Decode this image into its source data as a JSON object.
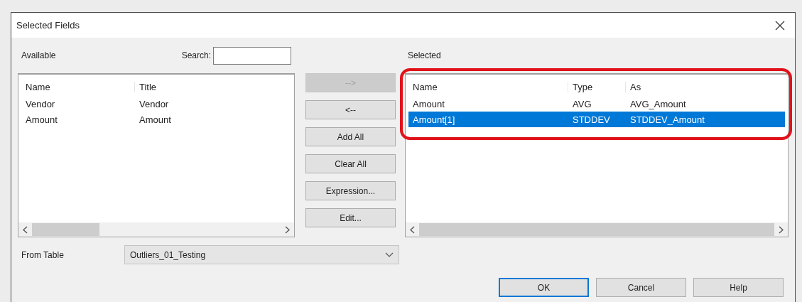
{
  "window": {
    "title": "Selected Fields"
  },
  "available": {
    "label": "Available",
    "search_label": "Search:",
    "columns": [
      "Name",
      "Title"
    ],
    "rows": [
      {
        "cells": [
          "Vendor",
          "Vendor"
        ]
      },
      {
        "cells": [
          "Amount",
          "Amount"
        ]
      }
    ]
  },
  "move_buttons": [
    {
      "label": "-->",
      "disabled": true
    },
    {
      "label": "<--",
      "disabled": false
    },
    {
      "label": "Add All",
      "disabled": false
    },
    {
      "label": "Clear All",
      "disabled": false
    },
    {
      "label": "Expression...",
      "disabled": false
    },
    {
      "label": "Edit...",
      "disabled": false
    }
  ],
  "selected": {
    "label": "Selected",
    "highlighted": true,
    "columns": [
      "Name",
      "Type",
      "As"
    ],
    "rows": [
      {
        "cells": [
          "Amount",
          "AVG",
          "AVG_Amount"
        ],
        "selected": false
      },
      {
        "cells": [
          "Amount[1]",
          "STDDEV",
          "STDDEV_Amount"
        ],
        "selected": true
      }
    ]
  },
  "from_table": {
    "label": "From Table",
    "value": "Outliers_01_Testing"
  },
  "buttons": [
    {
      "label": "OK",
      "default": true
    },
    {
      "label": "Cancel",
      "default": false
    },
    {
      "label": "Help",
      "default": false
    }
  ]
}
